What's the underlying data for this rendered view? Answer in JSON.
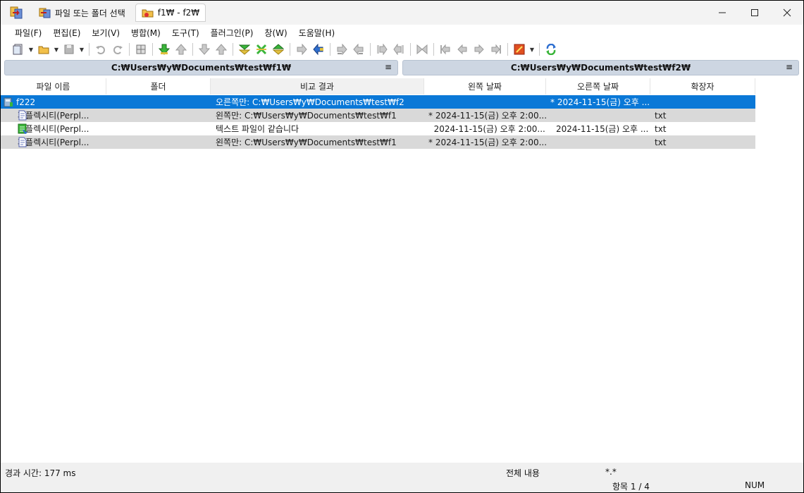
{
  "titlebar": {
    "tabs": [
      {
        "label": "파일 또는 폴더 선택",
        "active": false
      },
      {
        "label": "f1₩ - f2₩",
        "active": true
      }
    ]
  },
  "menu": [
    "파일(F)",
    "편집(E)",
    "보기(V)",
    "병합(M)",
    "도구(T)",
    "플러그인(P)",
    "창(W)",
    "도움말(H)"
  ],
  "paths": {
    "left": "C:₩Users₩y₩Documents₩test₩f1₩",
    "right": "C:₩Users₩y₩Documents₩test₩f2₩",
    "menu_glyph": "≡"
  },
  "columns": [
    "파일 이름",
    "폴더",
    "비교 결과",
    "왼쪽 날짜",
    "오른쪽 날짜",
    "확장자"
  ],
  "rows": [
    {
      "icon": "folder-right-only-icon",
      "name": "f222",
      "folder": "",
      "result": "오른쪽만: C:₩Users₩y₩Documents₩test₩f2",
      "ldate": "",
      "rdate": "* 2024-11-15(금) 오후 ...",
      "ext": "",
      "style": "selected"
    },
    {
      "icon": "file-left-only-icon",
      "name": "퍼플렉시티(Perpl...",
      "folder": "",
      "result": "왼쪽만: C:₩Users₩y₩Documents₩test₩f1",
      "ldate": "* 2024-11-15(금) 오후 2:00...",
      "rdate": "",
      "ext": "txt",
      "style": "gray"
    },
    {
      "icon": "file-identical-icon",
      "name": "퍼플렉시티(Perpl...",
      "folder": "",
      "result": "텍스트 파일이 같습니다",
      "ldate": "  2024-11-15(금) 오후 2:00...",
      "rdate": "2024-11-15(금) 오후 ...",
      "ext": "txt",
      "style": "white"
    },
    {
      "icon": "file-left-only-icon",
      "name": "퍼플렉시티(Perpl...",
      "folder": "",
      "result": "왼쪽만: C:₩Users₩y₩Documents₩test₩f1",
      "ldate": "* 2024-11-15(금) 오후 2:00...",
      "rdate": "",
      "ext": "txt",
      "style": "gray"
    }
  ],
  "status": {
    "elapsed": "경과 시간: 177 ms",
    "filter_label": "전체 내용",
    "filter_value": "*.*",
    "items": "항목 1 / 4",
    "num": "NUM"
  },
  "colors": {
    "selection": "#0a78d7",
    "row_gray": "#d9d9d9",
    "pathbar": "#cdd6e2"
  }
}
